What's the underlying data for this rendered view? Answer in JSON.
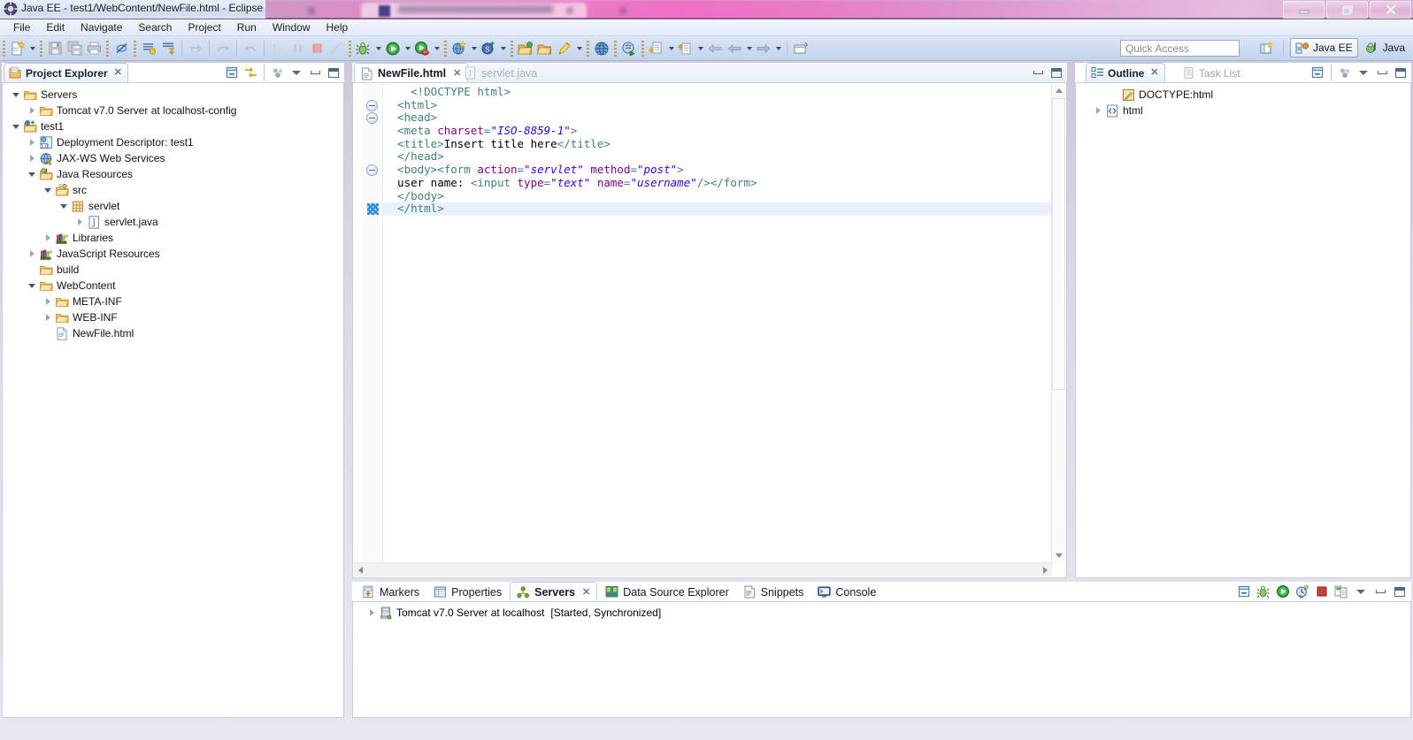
{
  "window": {
    "title": "Java EE - test1/WebContent/NewFile.html - Eclipse",
    "icon": "eclipse-icon",
    "controls": {
      "minimize": "–",
      "restore": "❐",
      "close": "✕"
    }
  },
  "menubar": {
    "items": [
      "File",
      "Edit",
      "Navigate",
      "Search",
      "Project",
      "Run",
      "Window",
      "Help"
    ]
  },
  "toolbar": {
    "quick_access_placeholder": "Quick Access",
    "perspectives": [
      {
        "label": "Java EE",
        "icon": "java-ee-perspective-icon",
        "active": true
      },
      {
        "label": "Java",
        "icon": "java-perspective-icon",
        "active": false
      }
    ],
    "open_perspective_icon": "open-perspective-icon",
    "groups": [
      {
        "icons": [
          "new-wizard-icon",
          "dropdown-arrow"
        ]
      },
      {
        "icons": [
          "save-icon",
          "save-all-icon",
          "print-icon"
        ]
      },
      {
        "icons": [
          "toggle-breakpoint-icon"
        ]
      },
      {
        "icons": [
          "new-java-file-icon",
          "toggle-mark-occurrences-icon"
        ]
      },
      {
        "icons": [
          "forward-step-icon",
          "back-step-icon",
          "step-return-icon"
        ]
      },
      {
        "icons": [
          "resume-icon",
          "suspend-icon",
          "terminate-icon",
          "disconnect-icon"
        ]
      },
      {
        "icons": [
          "debug-icon",
          "dropdown-arrow",
          "run-icon",
          "dropdown-arrow",
          "run-server-icon",
          "dropdown-arrow"
        ]
      },
      {
        "icons": [
          "new-web-project-icon",
          "dropdown-arrow",
          "new-servlet-icon",
          "dropdown-arrow"
        ]
      },
      {
        "icons": [
          "open-type-icon",
          "open-task-icon",
          "search-icon",
          "dropdown-arrow"
        ]
      },
      {
        "icons": [
          "web-browser-icon"
        ]
      },
      {
        "icons": [
          "run-as-icon"
        ]
      },
      {
        "icons": [
          "next-annotation-icon",
          "dropdown-arrow",
          "previous-annotation-icon",
          "dropdown-arrow"
        ]
      },
      {
        "icons": [
          "back-icon",
          "backward-history-icon",
          "dropdown-arrow",
          "forward-history-icon",
          "dropdown-arrow"
        ]
      },
      {
        "icons": [
          "restore-editor-icon"
        ]
      }
    ]
  },
  "project_explorer": {
    "tab_label": "Project Explorer",
    "tab_icon": "project-explorer-icon",
    "tab_close": "✕",
    "toolbar_icons": [
      "collapse-all-icon",
      "link-with-editor-icon",
      "view-menu-dots-icon",
      "view-menu-icon",
      "minimize-icon",
      "maximize-icon"
    ],
    "tree": [
      {
        "label": "Servers",
        "icon": "folder-icon",
        "indent": 0,
        "state": "expanded"
      },
      {
        "label": "Tomcat v7.0 Server at localhost-config",
        "icon": "folder-icon",
        "indent": 1,
        "state": "collapsed"
      },
      {
        "label": "test1",
        "icon": "dynamic-web-project-icon",
        "indent": 0,
        "state": "expanded"
      },
      {
        "label": "Deployment Descriptor: test1",
        "icon": "deployment-descriptor-icon",
        "indent": 1,
        "state": "collapsed"
      },
      {
        "label": "JAX-WS Web Services",
        "icon": "jaxws-icon",
        "indent": 1,
        "state": "collapsed"
      },
      {
        "label": "Java Resources",
        "icon": "java-resources-icon",
        "indent": 1,
        "state": "expanded"
      },
      {
        "label": "src",
        "icon": "source-folder-icon",
        "indent": 2,
        "state": "expanded"
      },
      {
        "label": "servlet",
        "icon": "package-icon",
        "indent": 3,
        "state": "expanded"
      },
      {
        "label": "servlet.java",
        "icon": "java-file-icon",
        "indent": 4,
        "state": "collapsed"
      },
      {
        "label": "Libraries",
        "icon": "libraries-icon",
        "indent": 2,
        "state": "collapsed"
      },
      {
        "label": "JavaScript Resources",
        "icon": "libraries-icon",
        "indent": 1,
        "state": "collapsed"
      },
      {
        "label": "build",
        "icon": "folder-icon",
        "indent": 1,
        "state": "none"
      },
      {
        "label": "WebContent",
        "icon": "folder-icon",
        "indent": 1,
        "state": "expanded"
      },
      {
        "label": "META-INF",
        "icon": "folder-icon",
        "indent": 2,
        "state": "collapsed"
      },
      {
        "label": "WEB-INF",
        "icon": "folder-icon",
        "indent": 2,
        "state": "collapsed"
      },
      {
        "label": "NewFile.html",
        "icon": "html-file-icon",
        "indent": 2,
        "state": "none"
      }
    ]
  },
  "editor": {
    "tabs": [
      {
        "label": "NewFile.html",
        "icon": "html-file-icon",
        "active": true,
        "close": "✕"
      },
      {
        "label": "servlet.java",
        "icon": "java-file-icon",
        "active": false,
        "close": ""
      }
    ],
    "toolbar_icons": [
      "minimize-icon",
      "maximize-icon"
    ],
    "lines": [
      {
        "fold": "none",
        "marker": "none",
        "highlight": false,
        "tokens": [
          {
            "t": "dtd",
            "s": "    <!DOCTYPE html>"
          }
        ]
      },
      {
        "fold": "minus",
        "marker": "none",
        "highlight": false,
        "tokens": [
          {
            "t": "tag",
            "s": "  <html>"
          }
        ]
      },
      {
        "fold": "minus",
        "marker": "none",
        "highlight": false,
        "tokens": [
          {
            "t": "tag",
            "s": "  <head>"
          }
        ]
      },
      {
        "fold": "none",
        "marker": "none",
        "highlight": false,
        "tokens": [
          {
            "t": "tag",
            "s": "  <meta "
          },
          {
            "t": "attr",
            "s": "charset"
          },
          {
            "t": "punct",
            "s": "="
          },
          {
            "t": "val",
            "s": "\"ISO-8859-1\""
          },
          {
            "t": "tag",
            "s": ">"
          }
        ]
      },
      {
        "fold": "none",
        "marker": "none",
        "highlight": false,
        "tokens": [
          {
            "t": "tag",
            "s": "  <title>"
          },
          {
            "t": "text",
            "s": "Insert title here"
          },
          {
            "t": "tag",
            "s": "</title>"
          }
        ]
      },
      {
        "fold": "none",
        "marker": "none",
        "highlight": false,
        "tokens": [
          {
            "t": "tag",
            "s": "  </head>"
          }
        ]
      },
      {
        "fold": "minus",
        "marker": "none",
        "highlight": false,
        "tokens": [
          {
            "t": "tag",
            "s": "  <body><form "
          },
          {
            "t": "attr",
            "s": "action"
          },
          {
            "t": "punct",
            "s": "="
          },
          {
            "t": "val",
            "s": "\"servlet\""
          },
          {
            "t": "tag",
            "s": " "
          },
          {
            "t": "attr",
            "s": "method"
          },
          {
            "t": "punct",
            "s": "="
          },
          {
            "t": "val",
            "s": "\"post\""
          },
          {
            "t": "tag",
            "s": ">"
          }
        ]
      },
      {
        "fold": "none",
        "marker": "none",
        "highlight": false,
        "tokens": [
          {
            "t": "text",
            "s": "  user name: "
          },
          {
            "t": "tag",
            "s": "<input "
          },
          {
            "t": "attr",
            "s": "type"
          },
          {
            "t": "punct",
            "s": "="
          },
          {
            "t": "val",
            "s": "\"text\""
          },
          {
            "t": "tag",
            "s": " "
          },
          {
            "t": "attr",
            "s": "name"
          },
          {
            "t": "punct",
            "s": "="
          },
          {
            "t": "val",
            "s": "\"username\""
          },
          {
            "t": "tag",
            "s": "/></form>"
          }
        ]
      },
      {
        "fold": "none",
        "marker": "none",
        "highlight": false,
        "tokens": [
          {
            "t": "tag",
            "s": "  </body>"
          }
        ]
      },
      {
        "fold": "none",
        "marker": "cursor",
        "highlight": true,
        "tokens": [
          {
            "t": "tag",
            "s": "  </html>"
          }
        ]
      }
    ]
  },
  "outline": {
    "tabs": [
      {
        "label": "Outline",
        "icon": "outline-icon",
        "active": true,
        "close": "✕"
      },
      {
        "label": "Task List",
        "icon": "task-list-icon",
        "active": false,
        "close": ""
      }
    ],
    "toolbar_icons": [
      "collapse-all-icon",
      "view-menu-dots-icon",
      "view-menu-icon",
      "minimize-icon",
      "maximize-icon"
    ],
    "tree": [
      {
        "label": "DOCTYPE:html",
        "icon": "doctype-icon",
        "indent": 1,
        "state": "none"
      },
      {
        "label": "html",
        "icon": "html-element-icon",
        "indent": 0,
        "state": "collapsed"
      }
    ]
  },
  "bottom_panel": {
    "tabs": [
      {
        "label": "Markers",
        "icon": "markers-icon",
        "active": false,
        "close": ""
      },
      {
        "label": "Properties",
        "icon": "properties-icon",
        "active": false,
        "close": ""
      },
      {
        "label": "Servers",
        "icon": "servers-icon",
        "active": true,
        "close": "✕"
      },
      {
        "label": "Data Source Explorer",
        "icon": "data-source-explorer-icon",
        "active": false,
        "close": ""
      },
      {
        "label": "Snippets",
        "icon": "snippets-icon",
        "active": false,
        "close": ""
      },
      {
        "label": "Console",
        "icon": "console-icon",
        "active": false,
        "close": ""
      }
    ],
    "toolbar_icons": [
      "collapse-all-icon",
      "debug-server-icon",
      "start-server-icon",
      "profile-server-icon",
      "stop-server-icon",
      "publish-icon",
      "view-menu-icon",
      "minimize-icon",
      "maximize-icon"
    ],
    "rows": [
      {
        "icon": "server-icon",
        "name": "Tomcat v7.0 Server at localhost",
        "status": "[Started, Synchronized]",
        "state": "collapsed"
      }
    ]
  },
  "colors": {
    "accent": "#2a00ff",
    "tag": "#3f7f7f",
    "attr": "#7f007f",
    "highlight_line": "#e8f2fd",
    "toolbar_bg": "#cddcf0",
    "panel_border": "#c3cfdf"
  }
}
